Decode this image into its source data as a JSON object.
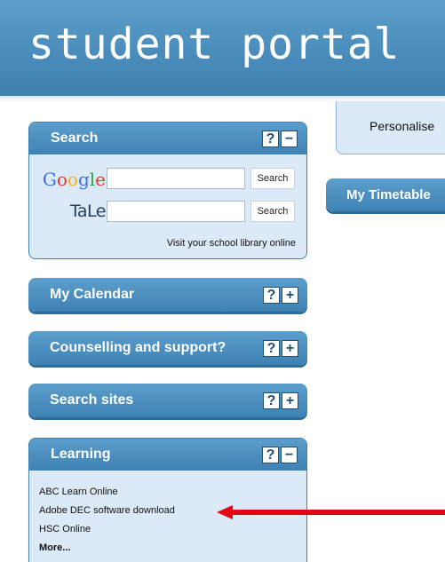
{
  "header": {
    "title": "student portal"
  },
  "right": {
    "personalise_label": "Personalise",
    "timetable_label": "My Timetable"
  },
  "panels": {
    "search": {
      "title": "Search",
      "help": "?",
      "toggle": "−",
      "google": {
        "logo_letters": [
          "G",
          "o",
          "o",
          "g",
          "l",
          "e"
        ],
        "logo_colors": [
          "#3b6ee8",
          "#e03b2f",
          "#f2b41c",
          "#3b6ee8",
          "#2da44e",
          "#e03b2f"
        ],
        "value": "",
        "button": "Search"
      },
      "tale": {
        "logo": "TaLe",
        "value": "",
        "button": "Search"
      },
      "library_link": "Visit your school library online"
    },
    "calendar": {
      "title": "My Calendar",
      "help": "?",
      "toggle": "+"
    },
    "counselling": {
      "title": "Counselling and support?",
      "help": "?",
      "toggle": "+"
    },
    "search_sites": {
      "title": "Search sites",
      "help": "?",
      "toggle": "+"
    },
    "learning": {
      "title": "Learning",
      "help": "?",
      "toggle": "−",
      "items": [
        "ABC Learn Online",
        "Adobe DEC software download",
        "HSC Online"
      ],
      "more": "More..."
    }
  },
  "annotation": {
    "arrow_color": "#e30613"
  }
}
